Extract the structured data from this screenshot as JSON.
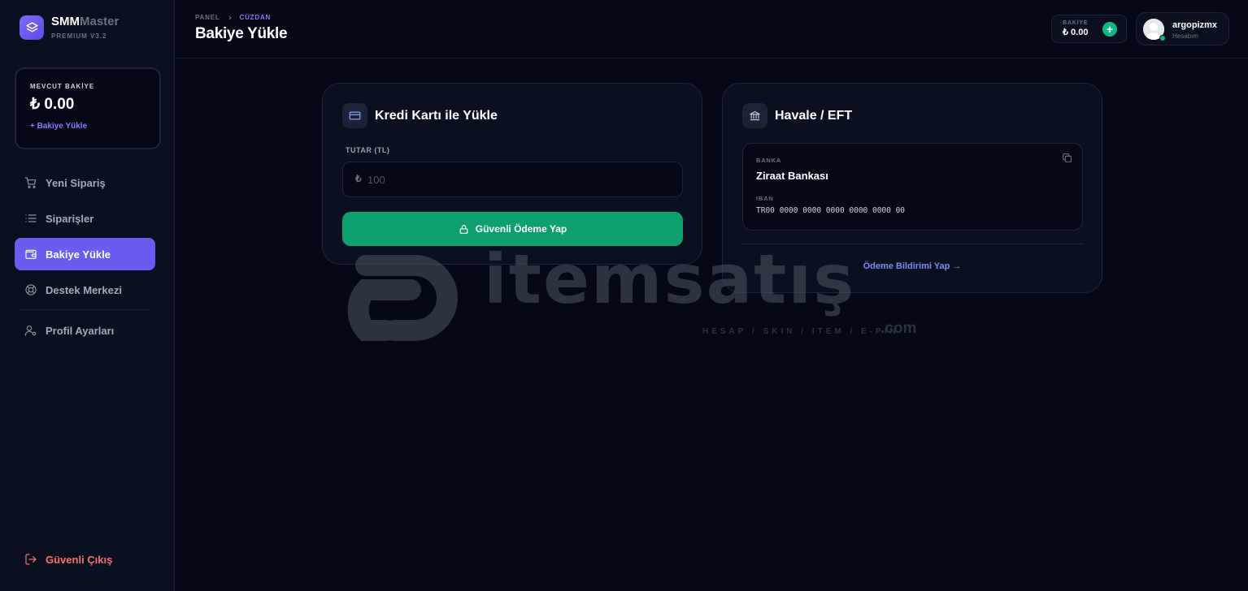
{
  "brand": {
    "name_primary": "SMM",
    "name_secondary": "Master",
    "version": "PREMIUM V3.2",
    "logo_icon": "layers-icon"
  },
  "sidebar": {
    "balance_label": "MEVCUT BAKİYE",
    "balance_amount": "₺ 0.00",
    "topup_link": "+ Bakiye Yükle",
    "items": [
      {
        "label": "Yeni Sipariş",
        "icon": "cart-icon",
        "active": false
      },
      {
        "label": "Siparişler",
        "icon": "list-icon",
        "active": false
      },
      {
        "label": "Bakiye Yükle",
        "icon": "wallet-icon",
        "active": true
      },
      {
        "label": "Destek Merkezi",
        "icon": "lifebuoy-icon",
        "active": false
      },
      {
        "label": "Profil Ayarları",
        "icon": "user-settings-icon",
        "active": false
      }
    ],
    "logout_label": "Güvenli Çıkış"
  },
  "header": {
    "breadcrumb": [
      "PANEL",
      "CÜZDAN"
    ],
    "title": "Bakiye Yükle",
    "balance_label": "BAKİYE",
    "balance_amount": "₺ 0.00",
    "user_name": "argopizmx",
    "user_sub": "Hesabım"
  },
  "credit_card": {
    "title": "Kredi Kartı ile Yükle",
    "amount_label": "TUTAR (TL)",
    "currency_symbol": "₺",
    "amount_placeholder": "100",
    "pay_button": "Güvenli Ödeme Yap"
  },
  "bank_transfer": {
    "title": "Havale / EFT",
    "bank_label": "BANKA",
    "bank_name": "Ziraat Bankası",
    "iban_label": "IBAN",
    "iban": "TR00 0000 0000 0000 0000 0000 00",
    "notify_link": "Ödeme Bildirimi Yap →"
  },
  "watermark": {
    "text": "itemsatış",
    "sub": "HESAP / SKIN / ITEM / E-PIN",
    "com": ".com"
  },
  "colors": {
    "accent": "#6a5cf0",
    "success": "#0e9f6e",
    "danger": "#f87171",
    "background": "#050816",
    "surface": "#0b1020"
  }
}
